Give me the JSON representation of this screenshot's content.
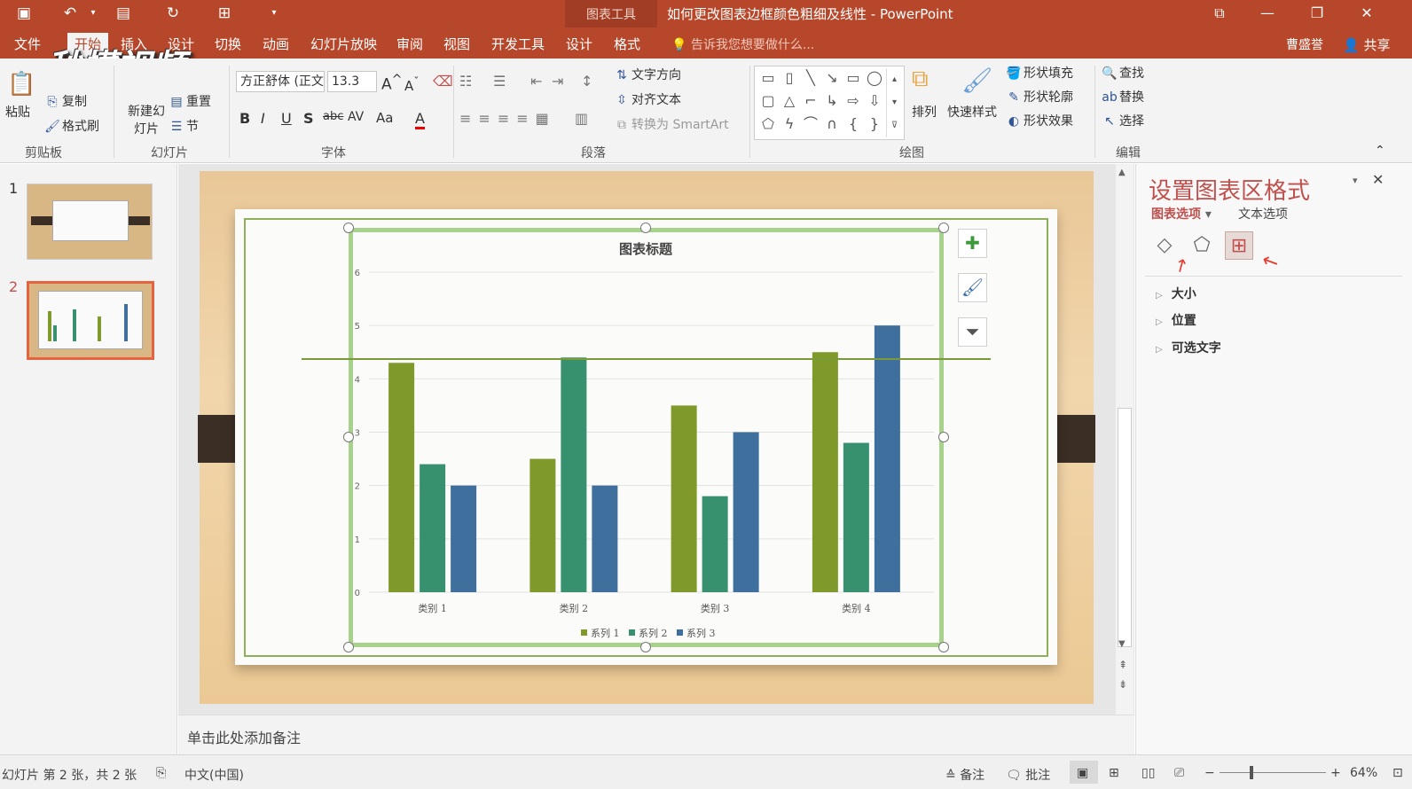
{
  "window": {
    "context_label": "图表工具",
    "title": "如何更改图表边框颜色粗细及线性 - PowerPoint"
  },
  "watermark": "秒懂视频",
  "tabs": [
    "文件",
    "开始",
    "插入",
    "设计",
    "切换",
    "动画",
    "幻灯片放映",
    "审阅",
    "视图",
    "开发工具",
    "设计",
    "格式"
  ],
  "tell_me": "告诉我您想要做什么...",
  "user": "曹盛誉",
  "share": "共享",
  "ribbon": {
    "clipboard": {
      "paste": "粘贴",
      "copy": "复制",
      "format_painter": "格式刷",
      "label": "剪贴板"
    },
    "slides": {
      "new_slide": "新建幻灯片",
      "reset": "重置",
      "section": "节",
      "label": "幻灯片"
    },
    "font": {
      "name": "方正舒体 (正文",
      "size": "13.3",
      "label": "字体"
    },
    "paragraph": {
      "text_direction": "文字方向",
      "align_text": "对齐文本",
      "smartart": "转换为 SmartArt",
      "label": "段落"
    },
    "drawing": {
      "arrange": "排列",
      "quick_styles": "快速样式",
      "fill": "形状填充",
      "outline": "形状轮廓",
      "effects": "形状效果",
      "label": "绘图"
    },
    "editing": {
      "find": "查找",
      "replace": "替换",
      "select": "选择",
      "label": "编辑"
    }
  },
  "thumbs": [
    {
      "num": "1"
    },
    {
      "num": "2"
    }
  ],
  "notes": "单击此处添加备注",
  "chart_data": {
    "type": "bar",
    "title": "图表标题",
    "categories": [
      "类别 1",
      "类别 2",
      "类别 3",
      "类别 4"
    ],
    "series": [
      {
        "name": "系列 1",
        "values": [
          4.3,
          2.5,
          3.5,
          4.5
        ],
        "color": "#7f9a2a"
      },
      {
        "name": "系列 2",
        "values": [
          2.4,
          4.4,
          1.8,
          2.8
        ],
        "color": "#37906e"
      },
      {
        "name": "系列 3",
        "values": [
          2,
          2,
          3,
          5
        ],
        "color": "#3f6f9c"
      }
    ],
    "ylim": [
      0,
      6
    ],
    "yticks": [
      "0",
      "1",
      "2",
      "3",
      "4",
      "5",
      "6"
    ],
    "grid": true,
    "legend": "bottom"
  },
  "pane": {
    "title": "设置图表区格式",
    "tab_chart": "图表选项",
    "tab_text": "文本选项",
    "rows": [
      "大小",
      "位置",
      "可选文字"
    ]
  },
  "status": {
    "slide_info": "幻灯片 第 2 张，共 2 张",
    "language": "中文(中国)",
    "notes": "备注",
    "comments": "批注",
    "zoom": "64%"
  },
  "colors": {
    "accent": "#b7472a",
    "pane_title": "#c0504d"
  }
}
